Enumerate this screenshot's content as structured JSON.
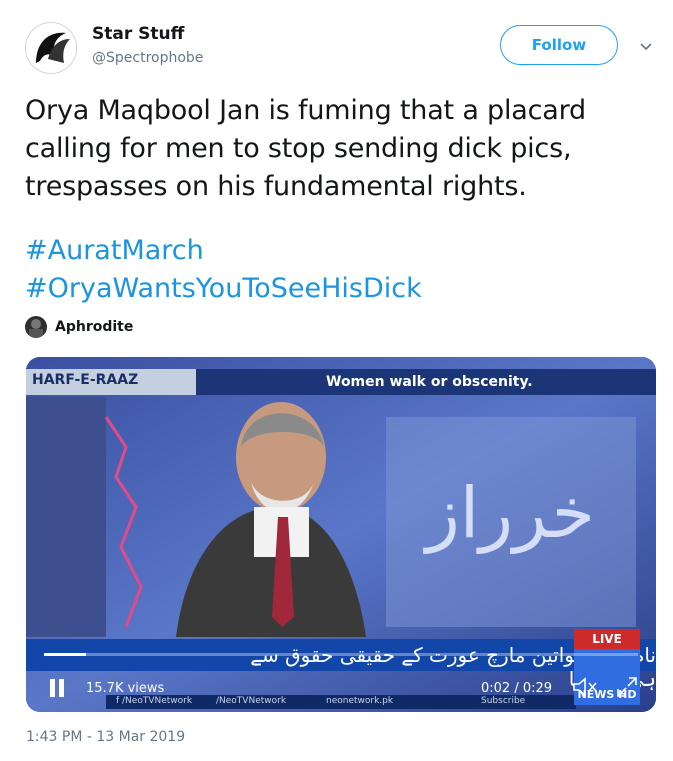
{
  "author": {
    "display_name": "Star Stuff",
    "handle": "@Spectrophobe"
  },
  "follow_label": "Follow",
  "tweet_text": "Orya Maqbool Jan is fuming that a placard calling for men to stop sending dick pics, trespasses on his fundamental rights.",
  "hashtags": [
    "#AuratMarch",
    "#OryaWantsYouToSeeHisDick"
  ],
  "attribution": {
    "name": "Aphrodite"
  },
  "video": {
    "show_name": "HARF-E-RAAZ",
    "headline": "Women walk or obscenity.",
    "ticker_urdu": "نام نہاد خواتین مارچ عورت کے حقیقی حقوق سے ہی نا آشنا",
    "live_label": "LIVE",
    "channel_label": "NEWS HD",
    "social": [
      "f /NeoTVNetwork",
      "/NeoTVNetwork",
      "neonetwork.pk",
      "Subscribe"
    ],
    "views": "15.7K views",
    "time": "0:02 / 0:29",
    "progress": 0.07
  },
  "timestamp": "1:43 PM - 13 Mar 2019",
  "colors": {
    "link": "#1b95e0",
    "follow": "#1da1f2",
    "muted": "#657786"
  }
}
